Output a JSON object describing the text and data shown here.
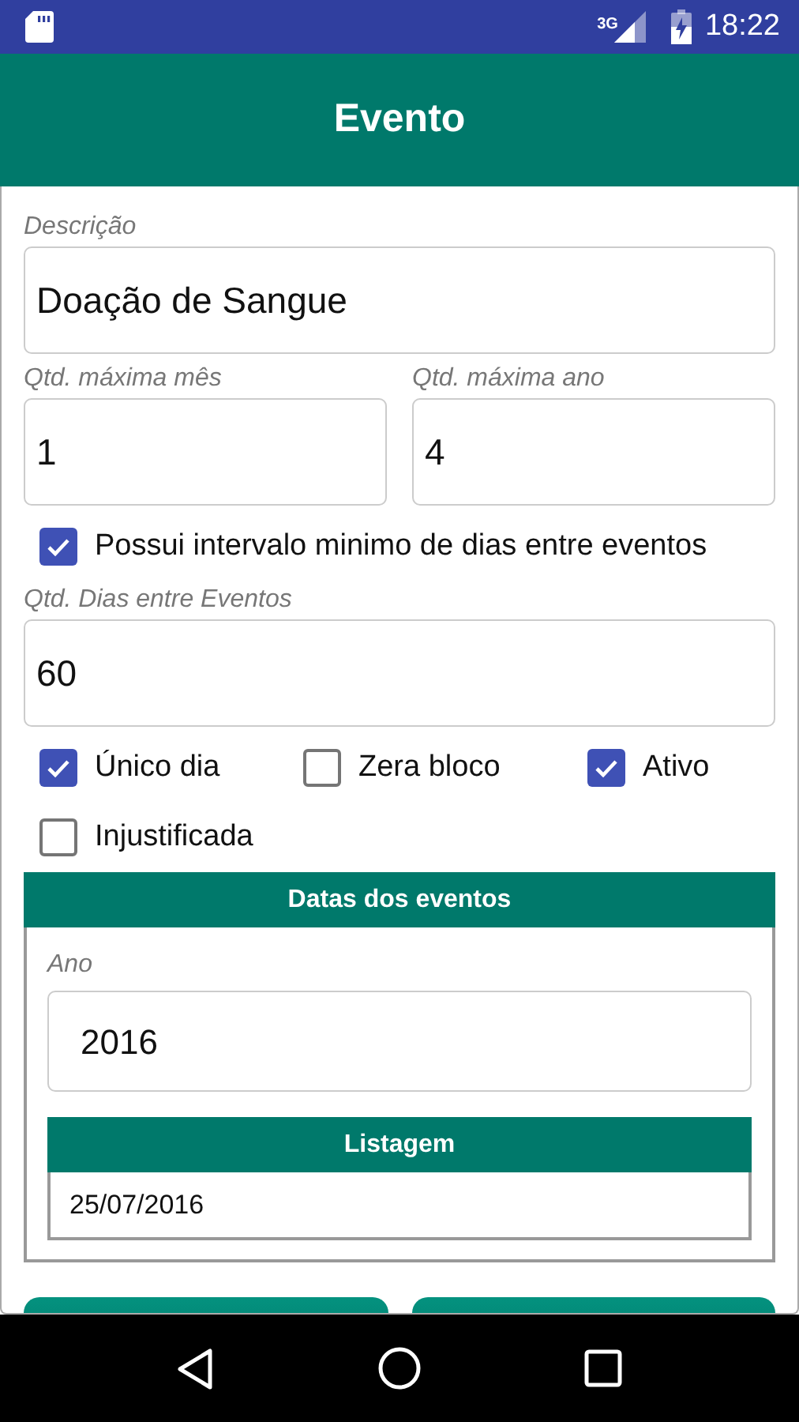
{
  "status_bar": {
    "network": "3G",
    "time": "18:22"
  },
  "app_bar": {
    "title": "Evento"
  },
  "form": {
    "description": {
      "label": "Descrição",
      "value": "Doação de Sangue"
    },
    "limits": [
      {
        "label": "Qtd. máxima mês",
        "value": "1"
      },
      {
        "label": "Qtd. máxima ano",
        "value": "4"
      }
    ],
    "interval_option": {
      "label": "Possui intervalo minimo de dias entre eventos",
      "checked": true
    },
    "days_between": {
      "label": "Qtd. Dias entre Eventos",
      "value": "60"
    },
    "options": [
      {
        "label": "Único dia",
        "checked": true
      },
      {
        "label": "Zera bloco",
        "checked": false
      },
      {
        "label": "Ativo",
        "checked": true
      },
      {
        "label": "Injustificada",
        "checked": false
      }
    ]
  },
  "event_dates": {
    "title": "Datas dos eventos",
    "year": {
      "label": "Ano",
      "value": "2016"
    },
    "list": {
      "title": "Listagem",
      "rows": [
        "25/07/2016"
      ]
    }
  }
}
